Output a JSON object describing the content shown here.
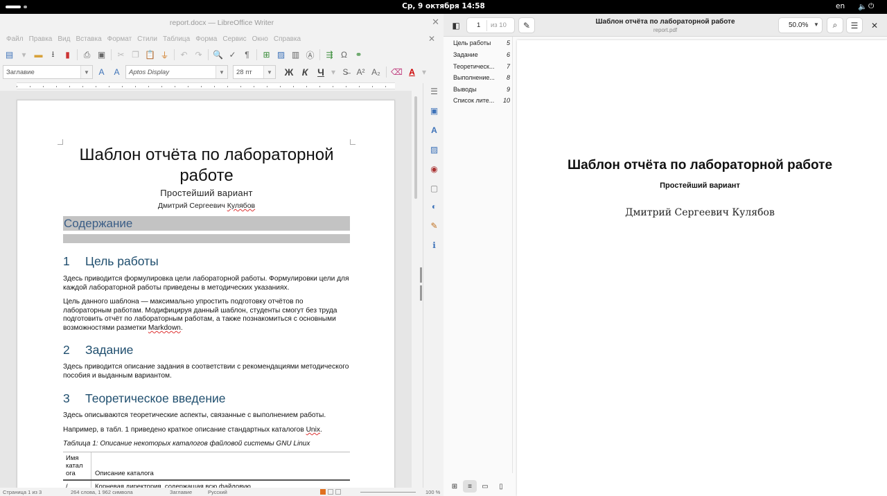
{
  "topbar": {
    "clock": "Ср, 9 октября  14:58",
    "lang": "en"
  },
  "writer": {
    "title": "report.docx — LibreOffice Writer",
    "menu": [
      "Файл",
      "Правка",
      "Вид",
      "Вставка",
      "Формат",
      "Стили",
      "Таблица",
      "Форма",
      "Сервис",
      "Окно",
      "Справка"
    ],
    "style_value": "Заглавие",
    "font_value": "Aptos Display",
    "size_value": "28 пт",
    "format_buttons": {
      "bold": "Ж",
      "italic": "К",
      "underline": "Ч"
    },
    "status": {
      "page": "Страница 1 из 3",
      "words": "264 слова, 1 962 символа",
      "style": "Заглавие",
      "lang": "Русский",
      "zoom": "100 %"
    }
  },
  "document": {
    "title": "Шаблон отчёта по лабораторной работе",
    "subtitle": "Простейший вариант",
    "author_given": "Дмитрий Сергеевич",
    "author_family": "Кулябов",
    "toc_heading": "Содержание",
    "sections": [
      {
        "num": "1",
        "title": "Цель работы"
      },
      {
        "num": "2",
        "title": "Задание"
      },
      {
        "num": "3",
        "title": "Теоретическое введение"
      }
    ],
    "p1": "Здесь приводится формулировка цели лабораторной работы. Формулировки цели для каждой лабораторной работы приведены в методических указаниях.",
    "p2_text": "Цель данного шаблона — максимально упростить подготовку отчётов по лабораторным работам. Модифицируя данный шаблон, студенты смогут без труда подготовить отчёт по лабораторным работам, а также познакомиться с основными возможностями разметки ",
    "p2_word": "Markdown",
    "p2_end": ".",
    "p3": "Здесь приводится описание задания в соответствии с рекомендациями методического пособия и выданным вариантом.",
    "p4": "Здесь описываются теоретические аспекты, связанные с выполнением работы.",
    "p5_text": "Например, в табл. 1 приведено краткое описание стандартных каталогов ",
    "p5_word": "Unix",
    "p5_end": ".",
    "caption": "Таблица 1: Описание некоторых каталогов файловой системы GNU Linux",
    "table_headers": [
      "Имя катал ога",
      "Описание каталога"
    ],
    "table_row": [
      "/",
      "Корневая директория, содержащая всю файловую"
    ]
  },
  "viewer": {
    "page_current": "1",
    "page_total": "из 10",
    "title": "Шаблон отчёта по лабораторной работе",
    "filename": "report.pdf",
    "zoom": "50.0%",
    "outline": [
      {
        "label": "Цель работы",
        "page": "5"
      },
      {
        "label": "Задание",
        "page": "6"
      },
      {
        "label": "Теоретическ...",
        "page": "7"
      },
      {
        "label": "Выполнение...",
        "page": "8"
      },
      {
        "label": "Выводы",
        "page": "9"
      },
      {
        "label": "Список лите...",
        "page": "10"
      }
    ],
    "pdf": {
      "title": "Шаблон отчёта по лабораторной работе",
      "subtitle": "Простейший вариант",
      "author": "Дмитрий Сергеевич Кулябов"
    }
  }
}
